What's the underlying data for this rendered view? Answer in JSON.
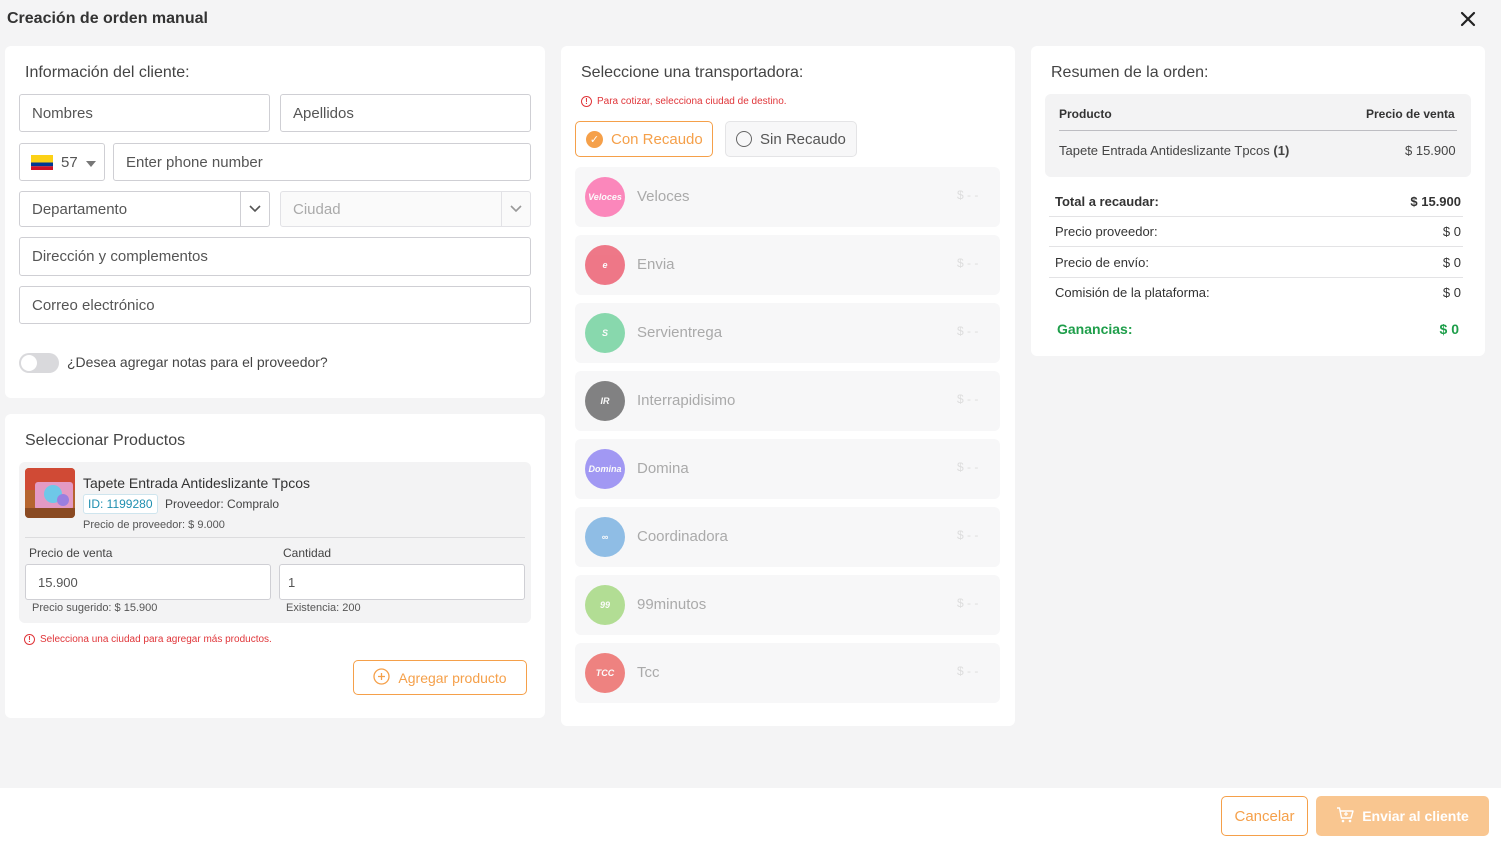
{
  "header": {
    "title": "Creación de orden manual"
  },
  "client": {
    "title": "Información del cliente:",
    "first_name_placeholder": "Nombres",
    "last_name_placeholder": "Apellidos",
    "country_code": "57",
    "phone_placeholder": "Enter phone number",
    "department_placeholder": "Departamento",
    "city_placeholder": "Ciudad",
    "address_placeholder": "Dirección y complementos",
    "email_placeholder": "Correo electrónico",
    "notes_toggle_label": "¿Desea agregar notas para el proveedor?"
  },
  "products": {
    "title": "Seleccionar Productos",
    "item": {
      "name": "Tapete Entrada Antideslizante Tpcos",
      "id": "ID: 1199280",
      "supplier": "Proveedor: Compralo",
      "supplier_price": "Precio de proveedor: $ 9.000",
      "sale_price_label": "Precio de venta",
      "sale_price_value": "15.900",
      "suggested_price": "Precio sugerido: $ 15.900",
      "quantity_label": "Cantidad",
      "quantity_value": "1",
      "stock": "Existencia: 200"
    },
    "error": "Selecciona una ciudad para agregar más productos.",
    "add_button": "Agregar producto"
  },
  "carriers": {
    "title": "Seleccione una transportadora:",
    "error": "Para cotizar, selecciona ciudad de destino.",
    "tab_with": "Con Recaudo",
    "tab_without": "Sin Recaudo",
    "list": [
      {
        "name": "Veloces",
        "price": "$ - -",
        "color": "#ff2d8a",
        "logo": "Veloces"
      },
      {
        "name": "Envia",
        "price": "$ - -",
        "color": "#e8102c",
        "logo": "e"
      },
      {
        "name": "Servientrega",
        "price": "$ - -",
        "color": "#2fbf71",
        "logo": "S"
      },
      {
        "name": "Interrapidisimo",
        "price": "$ - -",
        "color": "#222222",
        "logo": "IR"
      },
      {
        "name": "Domina",
        "price": "$ - -",
        "color": "#5b4cf0",
        "logo": "Domina"
      },
      {
        "name": "Coordinadora",
        "price": "$ - -",
        "color": "#3b8fd6",
        "logo": "∞"
      },
      {
        "name": "99minutos",
        "price": "$ - -",
        "color": "#7ac943",
        "logo": "99"
      },
      {
        "name": "Tcc",
        "price": "$ - -",
        "color": "#e8231f",
        "logo": "TCC"
      }
    ]
  },
  "summary": {
    "title": "Resumen de la orden:",
    "col_product": "Producto",
    "col_price": "Precio de venta",
    "product_name": "Tapete Entrada Antideslizante Tpcos",
    "product_qty": "(1)",
    "product_price": "$ 15.900",
    "total_label": "Total a recaudar:",
    "total_value": "$ 15.900",
    "supplier_label": "Precio proveedor:",
    "supplier_value": "$ 0",
    "shipping_label": "Precio de envío:",
    "shipping_value": "$ 0",
    "commission_label": "Comisión de la plataforma:",
    "commission_value": "$ 0",
    "profit_label": "Ganancias:",
    "profit_value": "$ 0"
  },
  "footer": {
    "cancel": "Cancelar",
    "send": "Enviar al cliente"
  },
  "colors": {
    "accent": "#f5a04a",
    "profit": "#1e9e4a",
    "error": "#e0363a"
  }
}
